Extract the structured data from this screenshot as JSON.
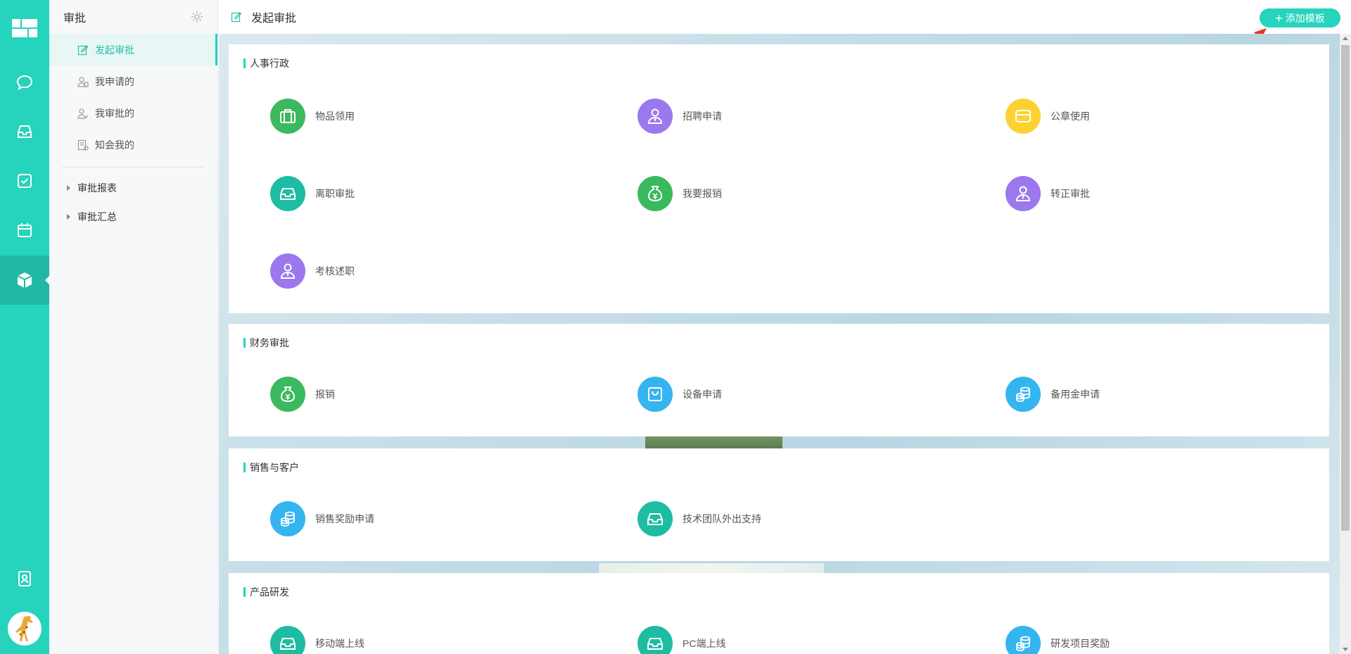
{
  "sidebar": {
    "title": "审批",
    "items": [
      {
        "label": "发起审批",
        "icon": "edit-icon",
        "active": true
      },
      {
        "label": "我申请的",
        "icon": "user-file-icon",
        "active": false
      },
      {
        "label": "我审批的",
        "icon": "user-check-icon",
        "active": false
      },
      {
        "label": "知会我的",
        "icon": "doc-share-icon",
        "active": false
      }
    ],
    "tree": [
      {
        "label": "审批报表"
      },
      {
        "label": "审批汇总"
      }
    ]
  },
  "header": {
    "title": "发起审批",
    "add_button_label": "添加模板"
  },
  "rail": {
    "icons": [
      "logo-grid-icon",
      "chat-icon",
      "inbox-icon",
      "task-check-icon",
      "calendar-icon",
      "cube-icon",
      "contacts-icon"
    ],
    "active": "cube-icon"
  },
  "colors": {
    "accent": "#26d3bd",
    "green": "#3bb95f",
    "purple": "#9b78ee",
    "yellow": "#fcd232",
    "teal": "#1fbca4",
    "blue": "#34b5f0"
  },
  "sections": [
    {
      "title": "人事行政",
      "items": [
        {
          "label": "物品领用",
          "icon": "briefcase-icon",
          "color": "#3bb95f"
        },
        {
          "label": "招聘申请",
          "icon": "person-tie-icon",
          "color": "#9b78ee"
        },
        {
          "label": "公章使用",
          "icon": "wallet-icon",
          "color": "#fcd232"
        },
        {
          "label": "离职审批",
          "icon": "inbox-tray-icon",
          "color": "#1fbca4"
        },
        {
          "label": "我要报销",
          "icon": "money-bag-icon",
          "color": "#3bb95f"
        },
        {
          "label": "转正审批",
          "icon": "person-tie-icon",
          "color": "#9b78ee"
        },
        {
          "label": "考核述职",
          "icon": "person-tie-icon",
          "color": "#9b78ee"
        }
      ]
    },
    {
      "title": "财务审批",
      "items": [
        {
          "label": "报销",
          "icon": "money-bag-icon",
          "color": "#3bb95f"
        },
        {
          "label": "设备申请",
          "icon": "shopping-bag-icon",
          "color": "#34b5f0"
        },
        {
          "label": "备用金申请",
          "icon": "coins-icon",
          "color": "#34b5f0"
        }
      ]
    },
    {
      "title": "销售与客户",
      "items": [
        {
          "label": "销售奖励申请",
          "icon": "coins-icon",
          "color": "#34b5f0"
        },
        {
          "label": "技术团队外出支持",
          "icon": "inbox-tray-icon",
          "color": "#1fbca4"
        }
      ]
    },
    {
      "title": "产品研发",
      "items": [
        {
          "label": "移动端上线",
          "icon": "inbox-tray-icon",
          "color": "#1fbca4"
        },
        {
          "label": "PC端上线",
          "icon": "inbox-tray-icon",
          "color": "#1fbca4"
        },
        {
          "label": "研发项目奖励",
          "icon": "coins-icon",
          "color": "#34b5f0"
        }
      ]
    }
  ]
}
